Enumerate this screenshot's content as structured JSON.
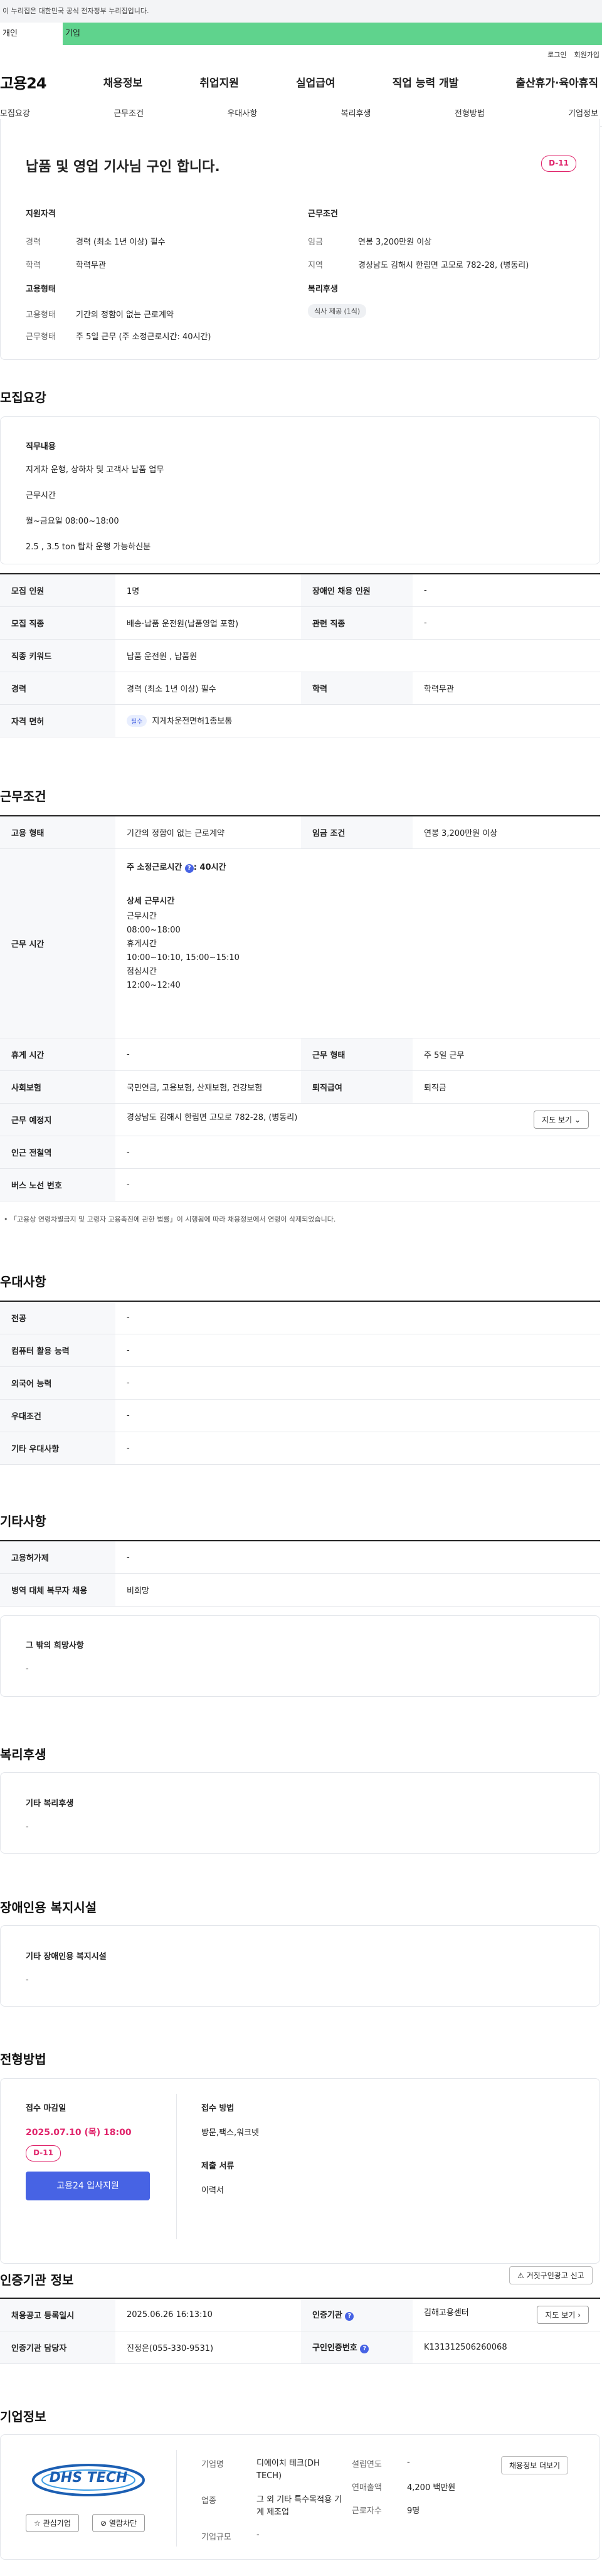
{
  "notice": "이 누리집은 대한민국 공식 전자정부 누리집입니다.",
  "user_tabs": [
    "개인",
    "기업"
  ],
  "util": [
    "로그인",
    "회원가입"
  ],
  "logo": "고용24",
  "gnb": [
    "채용정보",
    "취업지원",
    "실업급여",
    "직업 능력 개발",
    "출산휴가·육아휴직"
  ],
  "subnav": [
    "모집요강",
    "근무조건",
    "우대사항",
    "복리후생",
    "전형방법",
    "기업정보"
  ],
  "job": {
    "title": "납품 및 영업 기사님 구인 합니다.",
    "dday": "D-11",
    "qual_label": "지원자격",
    "career_k": "경력",
    "career_v": "경력 (최소 1년 이상) 필수",
    "edu_k": "학력",
    "edu_v": "학력무관",
    "cond_label": "근무조건",
    "wage_k": "임금",
    "wage_v": "연봉 3,200만원 이상",
    "area_k": "지역",
    "area_v": "경상남도 김해시 한림면 고모로 782-28, (병동리)",
    "emp_label": "고용형태",
    "emptype_k": "고용형태",
    "emptype_v": "기간의 정함이 없는 근로계약",
    "worktype_k": "근무형태",
    "worktype_v": "주 5일 근무 (주 소정근로시간: 40시간)",
    "welfare_label": "복리후생",
    "welfare_chip": "식사 제공 (1식)"
  },
  "recruit": {
    "title": "모집요강",
    "duty_label": "직무내용",
    "duty_lines": [
      "지게차 운행, 상하차 및 고객사 납품 업무",
      "근무시간",
      "월~금요일 08:00~18:00",
      "2.5 , 3.5 ton 탑차 운행 가능하신분"
    ],
    "rows": [
      [
        "모집 인원",
        "1명",
        "장애인 채용 인원",
        "-"
      ],
      [
        "모집 직종",
        "배송·납품 운전원(납품영업 포함)",
        "관련 직종",
        "-"
      ],
      [
        "직종 키워드",
        "납품 운전원 , 납품원"
      ],
      [
        "경력",
        "경력 (최소 1년 이상) 필수",
        "학력",
        "학력무관"
      ],
      [
        "자격 면허",
        "필수",
        "지게차운전면허1종보통"
      ]
    ]
  },
  "cond": {
    "title": "근무조건",
    "r1": [
      "고용 형태",
      "기간의 정함이 없는 근로계약",
      "임금 조건",
      "연봉 3,200만원 이상"
    ],
    "hours_h": "근무 시간",
    "hours_main": "주 소정근로시간",
    "hours_main_v": ": 40시간",
    "hours_detail": "상세 근무시간",
    "hours_lines": [
      "근무시간",
      "08:00~18:00",
      "휴게시간",
      "10:00~10:10, 15:00~15:10",
      "점심시간",
      "12:00~12:40"
    ],
    "r3": [
      "휴게 시간",
      "-",
      "근무 형태",
      "주 5일 근무"
    ],
    "r4": [
      "사회보험",
      "국민연금, 고용보험, 산재보험, 건강보험",
      "퇴직급여",
      "퇴직금"
    ],
    "r5": [
      "근무 예정지",
      "경상남도 김해시 한림면 고모로 782-28, (병동리)"
    ],
    "map_btn": "지도 보기",
    "r6": [
      "인근 전철역",
      "-"
    ],
    "r7": [
      "버스 노선 번호",
      "-"
    ],
    "note": "「고용상 연령차별금지 및 고령자 고용촉진에 관한 법률」이 시행됨에 따라 채용정보에서 연령이 삭제되었습니다."
  },
  "pref": {
    "title": "우대사항",
    "rows": [
      [
        "전공",
        "-"
      ],
      [
        "컴퓨터 활용 능력",
        "-"
      ],
      [
        "외국어 능력",
        "-"
      ],
      [
        "우대조건",
        "-"
      ],
      [
        "기타 우대사항",
        "-"
      ]
    ]
  },
  "etc": {
    "title": "기타사항",
    "rows": [
      [
        "고용허가제",
        "-"
      ],
      [
        "병역 대체 복무자 채용",
        "비희망"
      ]
    ],
    "wish_label": "그 밖의 희망사항",
    "wish_v": "-"
  },
  "welfare": {
    "title": "복리후생",
    "label": "기타 복리후생",
    "v": "-"
  },
  "disab": {
    "title": "장애인용 복지시설",
    "label": "기타 장애인용 복지시설",
    "v": "-"
  },
  "select": {
    "title": "전형방법",
    "deadline_label": "접수 마감일",
    "deadline": "2025.07.10 (목) 18:00",
    "dday": "D-11",
    "apply_btn": "고용24 입사지원",
    "method_label": "접수 방법",
    "method_v": "방문,팩스,워크넷",
    "docs_label": "제출 서류",
    "docs_v": "이력서"
  },
  "cert": {
    "title": "인증기관 정보",
    "report_btn": "거짓구인광고 신고",
    "rows": [
      [
        "채용공고 등록일시",
        "2025.06.26 16:13:10",
        "인증기관",
        "김해고용센터"
      ],
      [
        "인증기관 담당자",
        "진정은(055-330-9531)",
        "구인인증번호",
        "K131312506260068"
      ]
    ],
    "map_btn": "지도 보기"
  },
  "company": {
    "title": "기업정보",
    "logo_text": "DHS TECH",
    "fav_btn": "관심기업",
    "block_btn": "열람차단",
    "name_k": "기업명",
    "name_v": "디에이치 테크(DH TECH)",
    "ind_k": "업종",
    "ind_v": "그 외 기타 특수목적용 기계 제조업",
    "size_k": "기업규모",
    "size_v": "-",
    "est_k": "설립연도",
    "est_v": "-",
    "sales_k": "연매출액",
    "sales_v": "4,200 백만원",
    "emp_k": "근로자수",
    "emp_v": "9명",
    "jobs_btn": "채용정보 더보기"
  }
}
